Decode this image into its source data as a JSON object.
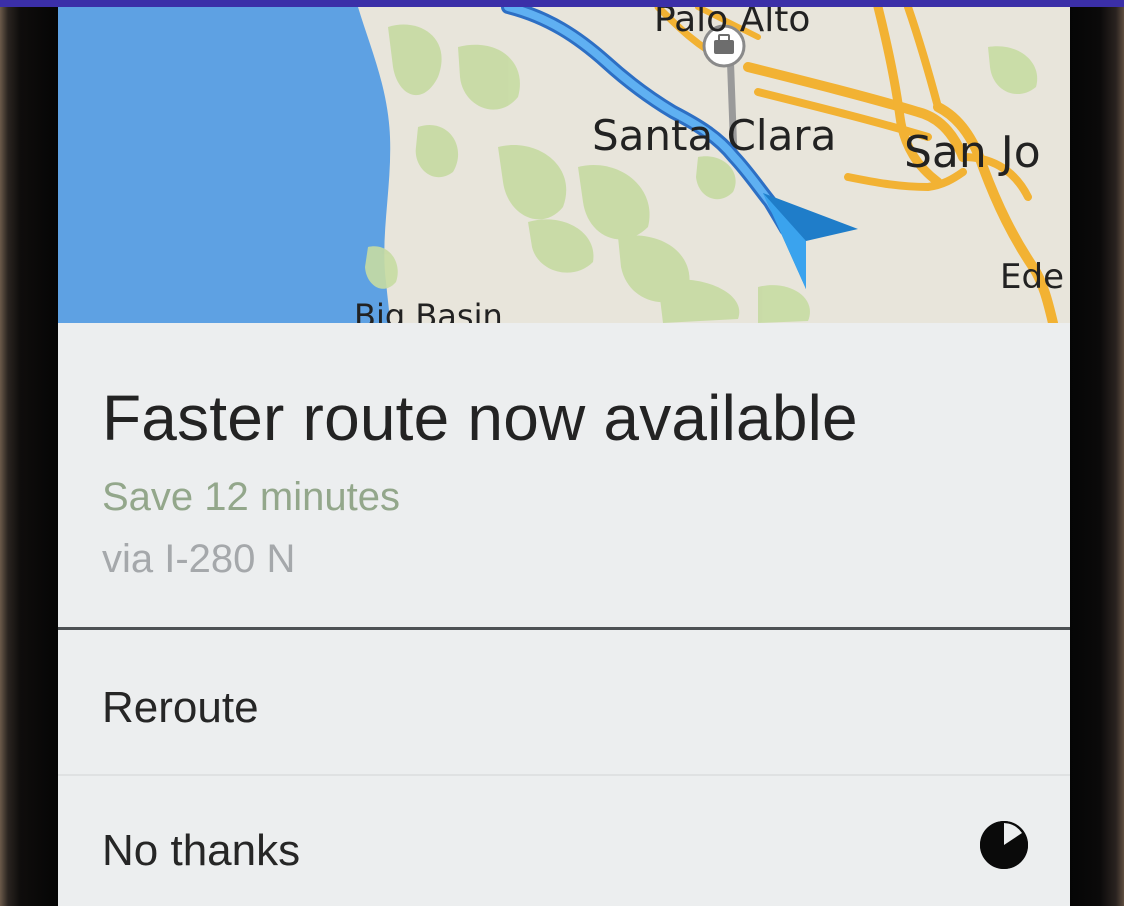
{
  "map": {
    "labels": {
      "palo_alto": "Palo Alto",
      "santa_clara": "Santa Clara",
      "san_jose": "San Jo",
      "eden": "Ede",
      "big_basin": "Big Basin"
    },
    "route_color": "#3c8ee5",
    "highway_color": "#f2b233",
    "water_color": "#5ea1e3",
    "park_color": "#c6dba2",
    "location_marker_icon": "navigation-arrow-icon",
    "poi_icon": "briefcase-icon"
  },
  "alert": {
    "title": "Faster route now available",
    "savings": "Save 12 minutes",
    "via": "via I-280 N",
    "reroute_label": "Reroute",
    "dismiss_label": "No thanks",
    "countdown_icon": "countdown-timer-icon"
  },
  "colors": {
    "savings_text": "#93a78b",
    "via_text": "#a5a8ab",
    "top_bar": "#3b2fa8"
  }
}
